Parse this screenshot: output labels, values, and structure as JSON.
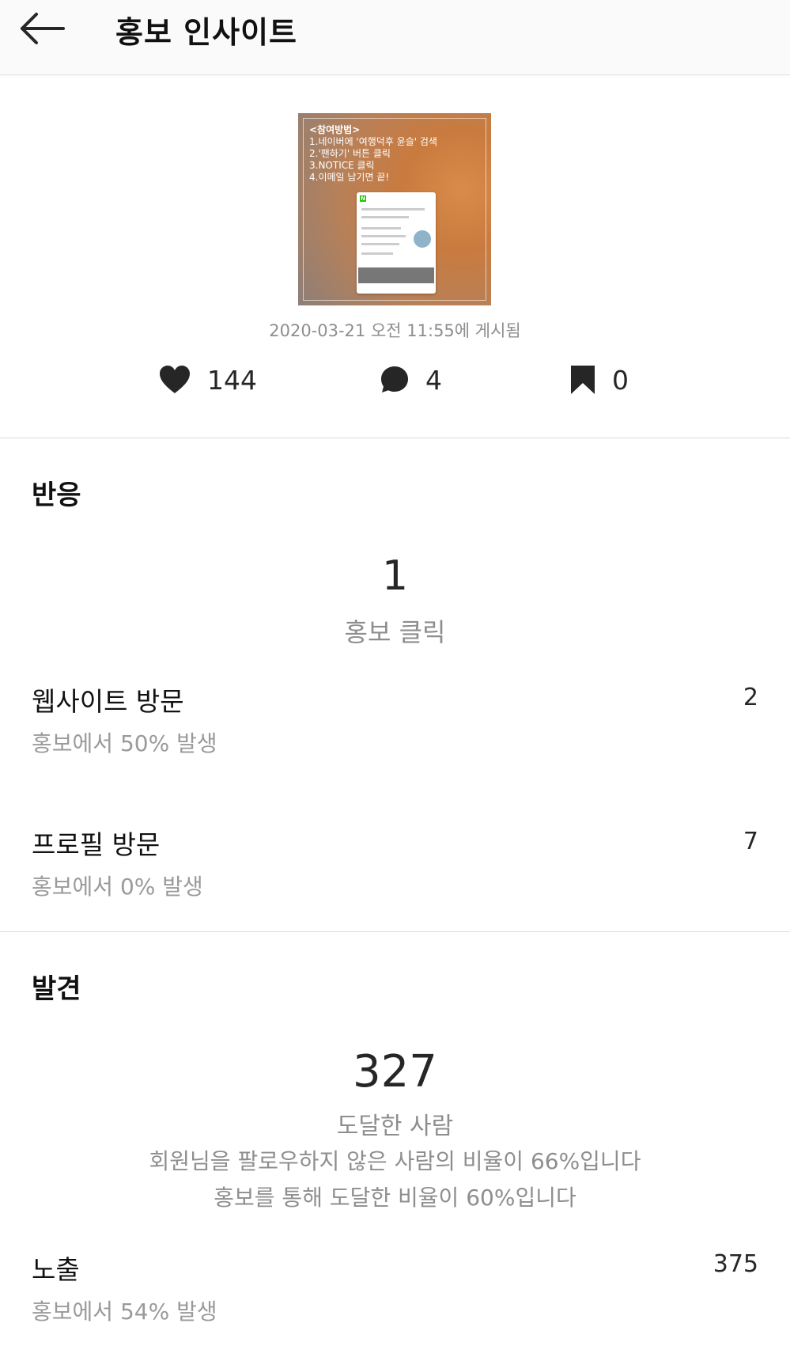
{
  "header": {
    "title": "홍보 인사이트",
    "back_icon": "arrow-left-icon"
  },
  "post": {
    "thumbnail_lines": [
      "<참여방법>",
      "1.네이버에 '여행덕후 윤슬' 검색",
      "2.'팬하기' 버튼 클릭",
      "3.NOTICE 클릭",
      "4.이메일 남기면 끝!"
    ],
    "posted_at": "2020-03-21 오전 11:55에 게시됨",
    "likes": "144",
    "comments": "4",
    "saves": "0"
  },
  "response": {
    "title": "반응",
    "main_value": "1",
    "main_label": "홍보 클릭",
    "rows": [
      {
        "label": "웹사이트 방문",
        "sub": "홍보에서 50% 발생",
        "value": "2"
      },
      {
        "label": "프로필 방문",
        "sub": "홍보에서 0% 발생",
        "value": "7"
      }
    ]
  },
  "discovery": {
    "title": "발견",
    "main_value": "327",
    "main_label": "도달한 사람",
    "note1": "회원님을 팔로우하지 않은 사람의 비율이 66%입니다",
    "note2": "홍보를 통해 도달한 비율이 60%입니다",
    "rows": [
      {
        "label": "노출",
        "sub": "홍보에서 54% 발생",
        "value": "375"
      }
    ]
  },
  "colors": {
    "header_bg": "#fafafa",
    "secondary_text": "#8e8e8e",
    "divider": "#dbdbdb"
  }
}
